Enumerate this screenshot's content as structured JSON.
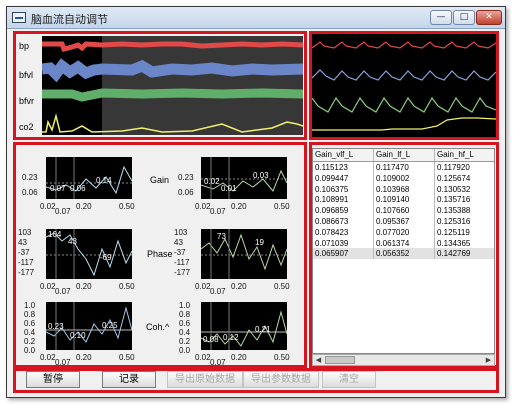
{
  "window": {
    "title": "脑血流自动调节",
    "min_label": "—",
    "max_label": "□",
    "close_label": "✕"
  },
  "monitor": {
    "channels": [
      "bp",
      "bfvl",
      "bfvr",
      "co2"
    ]
  },
  "colors": {
    "bp": "#e24a4a",
    "bfvl": "#6a86c8",
    "bfvr": "#5fae6a",
    "co2": "#f2f06a",
    "gain": "#b8e0f0",
    "phase": "#b7d8a8",
    "coh": "#a0c8e8"
  },
  "analysis": {
    "row_labels": [
      "Gain",
      "Phase",
      "Coh.^"
    ],
    "x_ticks": [
      "0.02",
      "0.07",
      "0.20",
      "0.50"
    ],
    "left": {
      "gain": {
        "y_ticks": [
          "0.23",
          "0.06"
        ],
        "values": [
          "0.07",
          "0.06",
          "0.14"
        ]
      },
      "phase": {
        "y_ticks": [
          "103",
          "43",
          "-37",
          "-117",
          "-177"
        ],
        "values": [
          "104",
          "43",
          "-69"
        ]
      },
      "coh": {
        "y_ticks": [
          "1.0",
          "0.8",
          "0.6",
          "0.4",
          "0.2",
          "0.0"
        ],
        "values": [
          "0.23",
          "0.10",
          "0.25"
        ]
      }
    },
    "right": {
      "gain": {
        "y_ticks": [
          "0.23",
          "0.06"
        ],
        "values": [
          "0.02",
          "0.01",
          "0.03"
        ]
      },
      "phase": {
        "y_ticks": [
          "103",
          "43",
          "-37",
          "-117",
          "-177"
        ],
        "values": [
          "73",
          "19"
        ]
      },
      "coh": {
        "y_ticks": [
          "1.0",
          "0.8",
          "0.6",
          "0.4",
          "0.2",
          "0.0"
        ],
        "values": [
          "0.08",
          "0.12",
          "0.21"
        ]
      }
    }
  },
  "table": {
    "headers": [
      "Gain_vlf_L",
      "Gain_lf_L",
      "Gain_hf_L"
    ],
    "rows": [
      [
        "0.115123",
        "0.117470",
        "0.117920"
      ],
      [
        "0.099447",
        "0.109002",
        "0.125674"
      ],
      [
        "0.106375",
        "0.103968",
        "0.130532"
      ],
      [
        "0.108991",
        "0.109140",
        "0.135716"
      ],
      [
        "0.096859",
        "0.107660",
        "0.135388"
      ],
      [
        "0.086673",
        "0.095367",
        "0.125316"
      ],
      [
        "0.078423",
        "0.077020",
        "0.125119"
      ],
      [
        "0.071039",
        "0.061374",
        "0.134365"
      ],
      [
        "0.065907",
        "0.056352",
        "0.142769"
      ]
    ],
    "selected_row": 8
  },
  "toolbar": {
    "pause": "暂停",
    "record": "记录",
    "export_raw": "导出原始数据",
    "export_params": "导出参数数据",
    "clear": "清空"
  }
}
